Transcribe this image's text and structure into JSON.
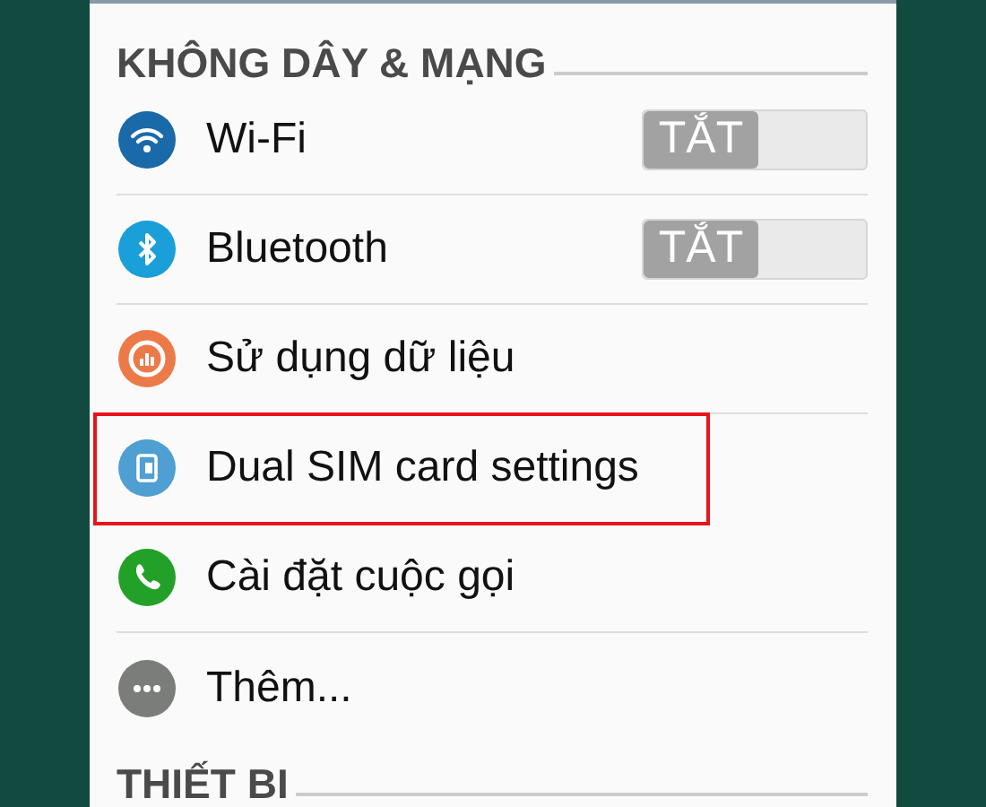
{
  "sections": [
    {
      "title": "KHÔNG DÂY & MẠNG",
      "items": [
        {
          "kind": "toggle",
          "label": "Wi-Fi",
          "switch_label": "TẮT",
          "on": false,
          "highlighted": false
        },
        {
          "kind": "toggle",
          "label": "Bluetooth",
          "switch_label": "TẮT",
          "on": false,
          "highlighted": false
        },
        {
          "kind": "link",
          "label": "Sử dụng dữ liệu",
          "highlighted": false
        },
        {
          "kind": "link",
          "label": "Dual SIM card settings",
          "highlighted": true
        },
        {
          "kind": "link",
          "label": "Cài đặt cuộc gọi",
          "highlighted": false
        },
        {
          "kind": "link",
          "label": "Thêm...",
          "highlighted": false
        }
      ]
    },
    {
      "title": "THIẾT BI"
    }
  ]
}
